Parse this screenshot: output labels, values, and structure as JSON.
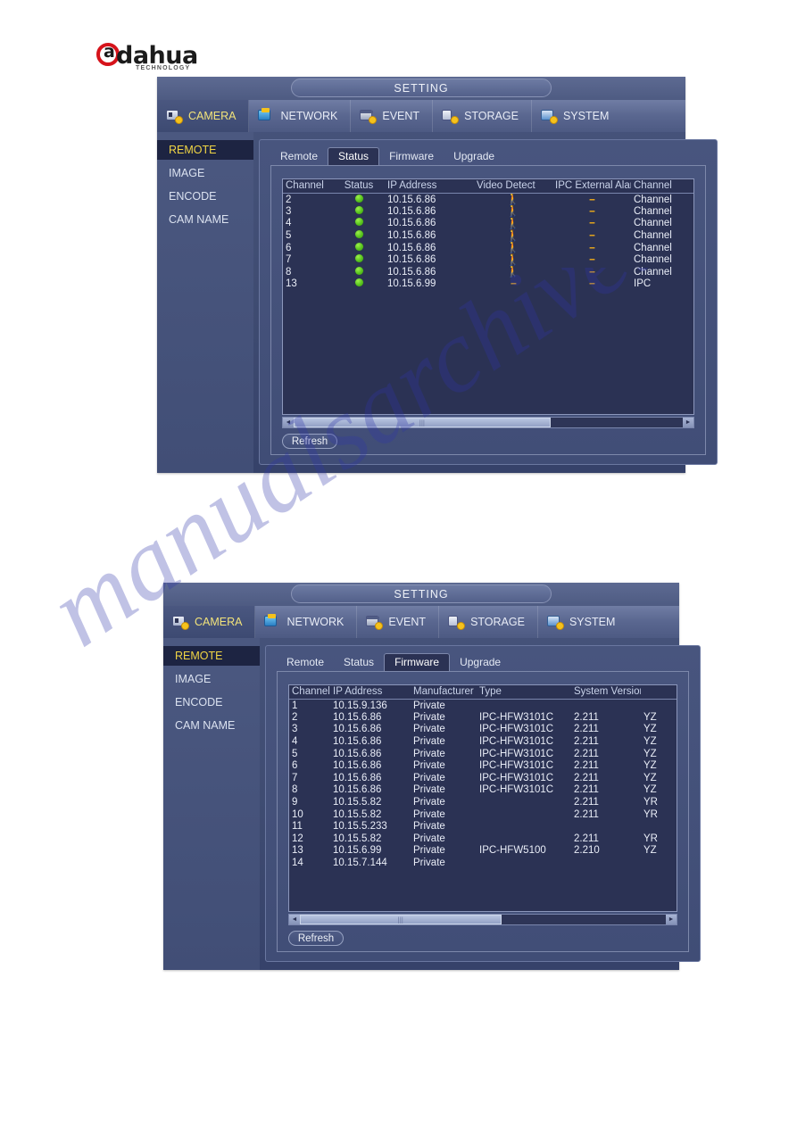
{
  "brand": {
    "name": "dahua",
    "tagline": "TECHNOLOGY",
    "mark_letter": "a"
  },
  "watermark": {
    "text": "manualsarchive.com"
  },
  "panels": [
    {
      "title": "SETTING",
      "nav": [
        {
          "label": "CAMERA",
          "icon": "camera-icon",
          "active": true
        },
        {
          "label": "NETWORK",
          "icon": "network-icon",
          "active": false
        },
        {
          "label": "EVENT",
          "icon": "event-icon",
          "active": false
        },
        {
          "label": "STORAGE",
          "icon": "storage-icon",
          "active": false
        },
        {
          "label": "SYSTEM",
          "icon": "system-icon",
          "active": false
        }
      ],
      "sidebar": [
        {
          "label": "REMOTE",
          "active": true
        },
        {
          "label": "IMAGE",
          "active": false
        },
        {
          "label": "ENCODE",
          "active": false
        },
        {
          "label": "CAM NAME",
          "active": false
        }
      ],
      "tabs": [
        {
          "label": "Remote",
          "active": false
        },
        {
          "label": "Status",
          "active": true
        },
        {
          "label": "Firmware",
          "active": false
        },
        {
          "label": "Upgrade",
          "active": false
        }
      ],
      "table": {
        "columns": [
          "Channel",
          "Status",
          "IP Address",
          "Video Detect",
          "IPC External Alarm",
          "Channel"
        ],
        "rows": [
          {
            "channel": "2",
            "status": "online",
            "ip": "10.15.6.86",
            "video_detect": "walk",
            "ipc_alarm": "--",
            "channel2": "Channel"
          },
          {
            "channel": "3",
            "status": "online",
            "ip": "10.15.6.86",
            "video_detect": "walk",
            "ipc_alarm": "--",
            "channel2": "Channel"
          },
          {
            "channel": "4",
            "status": "online",
            "ip": "10.15.6.86",
            "video_detect": "walk",
            "ipc_alarm": "--",
            "channel2": "Channel"
          },
          {
            "channel": "5",
            "status": "online",
            "ip": "10.15.6.86",
            "video_detect": "walk",
            "ipc_alarm": "--",
            "channel2": "Channel"
          },
          {
            "channel": "6",
            "status": "online",
            "ip": "10.15.6.86",
            "video_detect": "walk",
            "ipc_alarm": "--",
            "channel2": "Channel"
          },
          {
            "channel": "7",
            "status": "online",
            "ip": "10.15.6.86",
            "video_detect": "walk",
            "ipc_alarm": "--",
            "channel2": "Channel"
          },
          {
            "channel": "8",
            "status": "online",
            "ip": "10.15.6.86",
            "video_detect": "walk",
            "ipc_alarm": "--",
            "channel2": "Channel"
          },
          {
            "channel": "13",
            "status": "online",
            "ip": "10.15.6.99",
            "video_detect": "--",
            "ipc_alarm": "--",
            "channel2": "IPC"
          }
        ]
      },
      "scrollbar": {
        "left_arrow": "◄",
        "right_arrow": "►",
        "thumb_percent": 66
      },
      "refresh_label": "Refresh"
    },
    {
      "title": "SETTING",
      "nav": [
        {
          "label": "CAMERA",
          "icon": "camera-icon",
          "active": true
        },
        {
          "label": "NETWORK",
          "icon": "network-icon",
          "active": false
        },
        {
          "label": "EVENT",
          "icon": "event-icon",
          "active": false
        },
        {
          "label": "STORAGE",
          "icon": "storage-icon",
          "active": false
        },
        {
          "label": "SYSTEM",
          "icon": "system-icon",
          "active": false
        }
      ],
      "sidebar": [
        {
          "label": "REMOTE",
          "active": true
        },
        {
          "label": "IMAGE",
          "active": false
        },
        {
          "label": "ENCODE",
          "active": false
        },
        {
          "label": "CAM NAME",
          "active": false
        }
      ],
      "tabs": [
        {
          "label": "Remote",
          "active": false
        },
        {
          "label": "Status",
          "active": false
        },
        {
          "label": "Firmware",
          "active": true
        },
        {
          "label": "Upgrade",
          "active": false
        }
      ],
      "table": {
        "columns": [
          "Channel",
          "IP Address",
          "Manufacturer",
          "Type",
          "System Version",
          ""
        ],
        "rows": [
          {
            "channel": "1",
            "ip": "10.15.9.136",
            "manufacturer": "Private",
            "type": "",
            "version": "",
            "extra": ""
          },
          {
            "channel": "2",
            "ip": "10.15.6.86",
            "manufacturer": "Private",
            "type": "IPC-HFW3101C",
            "version": "2.211",
            "extra": "YZ"
          },
          {
            "channel": "3",
            "ip": "10.15.6.86",
            "manufacturer": "Private",
            "type": "IPC-HFW3101C",
            "version": "2.211",
            "extra": "YZ"
          },
          {
            "channel": "4",
            "ip": "10.15.6.86",
            "manufacturer": "Private",
            "type": "IPC-HFW3101C",
            "version": "2.211",
            "extra": "YZ"
          },
          {
            "channel": "5",
            "ip": "10.15.6.86",
            "manufacturer": "Private",
            "type": "IPC-HFW3101C",
            "version": "2.211",
            "extra": "YZ"
          },
          {
            "channel": "6",
            "ip": "10.15.6.86",
            "manufacturer": "Private",
            "type": "IPC-HFW3101C",
            "version": "2.211",
            "extra": "YZ"
          },
          {
            "channel": "7",
            "ip": "10.15.6.86",
            "manufacturer": "Private",
            "type": "IPC-HFW3101C",
            "version": "2.211",
            "extra": "YZ"
          },
          {
            "channel": "8",
            "ip": "10.15.6.86",
            "manufacturer": "Private",
            "type": "IPC-HFW3101C",
            "version": "2.211",
            "extra": "YZ"
          },
          {
            "channel": "9",
            "ip": "10.15.5.82",
            "manufacturer": "Private",
            "type": "",
            "version": "2.211",
            "extra": "YR"
          },
          {
            "channel": "10",
            "ip": "10.15.5.82",
            "manufacturer": "Private",
            "type": "",
            "version": "2.211",
            "extra": "YR"
          },
          {
            "channel": "11",
            "ip": "10.15.5.233",
            "manufacturer": "Private",
            "type": "",
            "version": "",
            "extra": ""
          },
          {
            "channel": "12",
            "ip": "10.15.5.82",
            "manufacturer": "Private",
            "type": "",
            "version": "2.211",
            "extra": "YR"
          },
          {
            "channel": "13",
            "ip": "10.15.6.99",
            "manufacturer": "Private",
            "type": "IPC-HFW5100",
            "version": "2.210",
            "extra": "YZ"
          },
          {
            "channel": "14",
            "ip": "10.15.7.144",
            "manufacturer": "Private",
            "type": "",
            "version": "",
            "extra": ""
          }
        ]
      },
      "scrollbar": {
        "left_arrow": "◄",
        "right_arrow": "►",
        "thumb_percent": 55
      },
      "refresh_label": "Refresh"
    }
  ],
  "colors": {
    "accent_yellow": "#f0d544",
    "status_green": "#58c41e",
    "dash_orange": "#e8a81c",
    "panel_blue": "#414e76",
    "grid_bg": "#2b3254"
  }
}
